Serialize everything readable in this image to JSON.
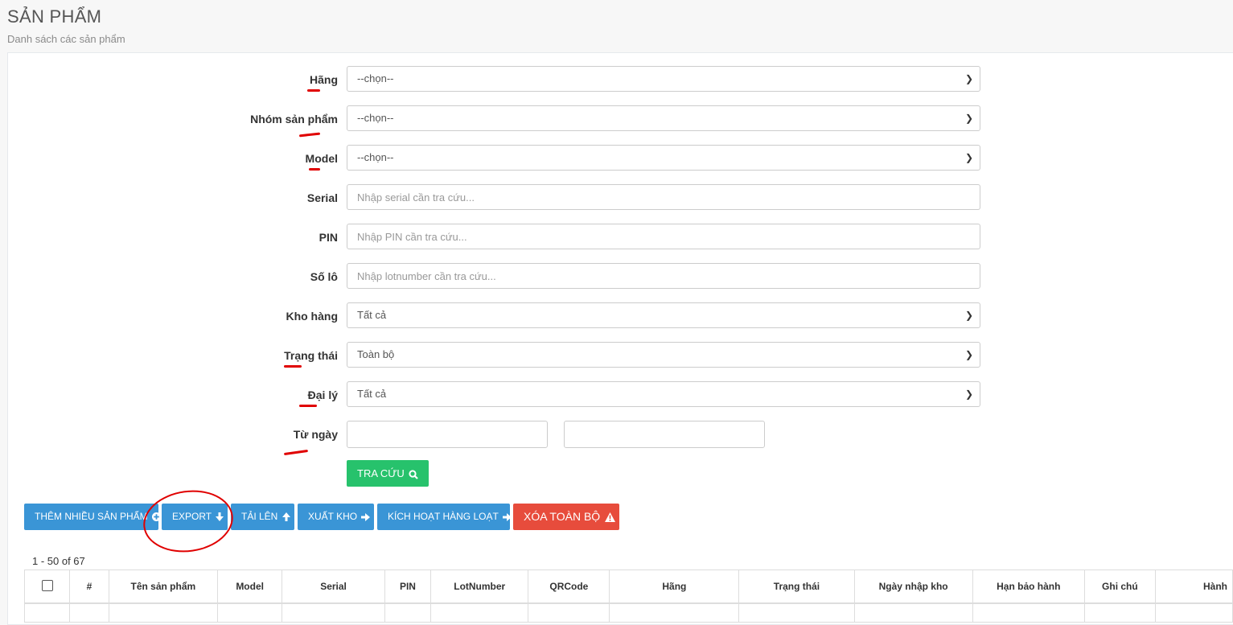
{
  "header": {
    "title": "SẢN PHẨM",
    "subtitle": "Danh sách các sản phẩm"
  },
  "filters": {
    "brand": {
      "label": "Hãng",
      "value": "--chọn--"
    },
    "group": {
      "label": "Nhóm sản phẩm",
      "value": "--chọn--"
    },
    "model": {
      "label": "Model",
      "value": "--chọn--"
    },
    "serial": {
      "label": "Serial",
      "placeholder": "Nhập serial cần tra cứu..."
    },
    "pin": {
      "label": "PIN",
      "placeholder": "Nhập PIN cần tra cứu..."
    },
    "lot": {
      "label": "Số lô",
      "placeholder": "Nhập lotnumber cần tra cứu..."
    },
    "warehouse": {
      "label": "Kho hàng",
      "value": "Tất cả"
    },
    "status": {
      "label": "Trạng thái",
      "value": "Toàn bộ"
    },
    "dealer": {
      "label": "Đại lý",
      "value": "Tất cả"
    },
    "from_date": {
      "label": "Từ ngày"
    },
    "search_button": "TRA CỨU"
  },
  "actions": {
    "add_many": "THÊM NHIỀU SẢN PHẨM",
    "export": "EXPORT",
    "upload": "TẢI LÊN",
    "warehouse_out": "XUẤT KHO",
    "bulk_activate": "KÍCH HOẠT HÀNG LOẠT",
    "delete_all": "XÓA TOÀN BỘ"
  },
  "pagination": {
    "range": "1 - 50 of 67"
  },
  "table": {
    "columns": [
      "#",
      "Tên sản phẩm",
      "Model",
      "Serial",
      "PIN",
      "LotNumber",
      "QRCode",
      "Hãng",
      "Trạng thái",
      "Ngày nhập kho",
      "Hạn bảo hành",
      "Ghi chú",
      "Hành"
    ]
  },
  "colors": {
    "primary": "#3a95d6",
    "success": "#27c26c",
    "danger": "#e74c3c",
    "annotation": "#e00000"
  },
  "icons": {
    "select": "chevron-down-icon",
    "search": "search-icon",
    "add": "plus-circle-icon",
    "download": "arrow-down-icon",
    "upload": "arrow-up-icon",
    "right": "arrow-right-icon",
    "warning": "warning-icon"
  }
}
